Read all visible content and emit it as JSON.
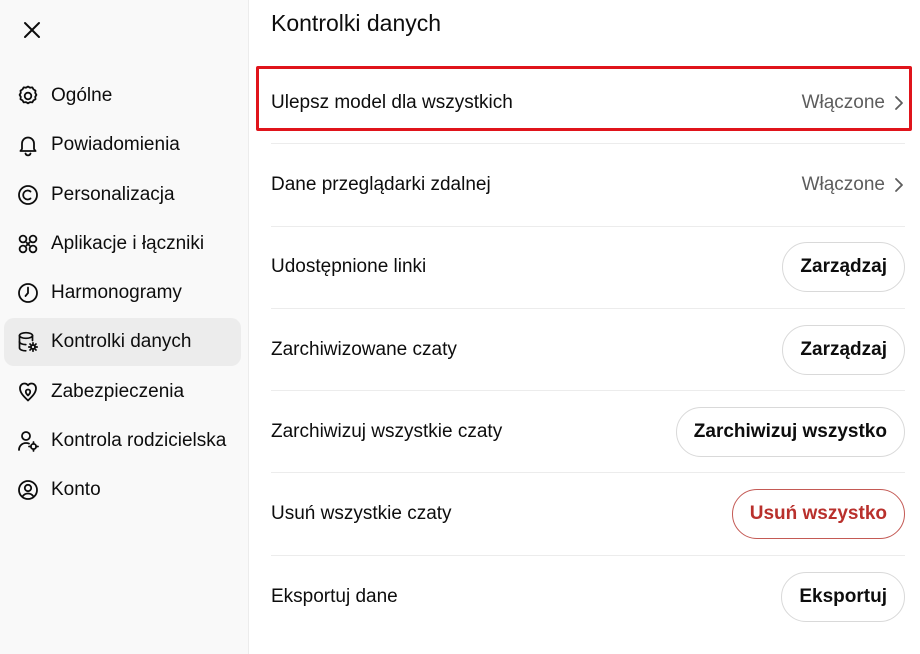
{
  "sidebar": {
    "close_icon": "close-icon",
    "items": [
      {
        "label": "Ogólne",
        "icon": "gear-icon"
      },
      {
        "label": "Powiadomienia",
        "icon": "bell-icon"
      },
      {
        "label": "Personalizacja",
        "icon": "personalization-icon"
      },
      {
        "label": "Aplikacje i łączniki",
        "icon": "apps-icon"
      },
      {
        "label": "Harmonogramy",
        "icon": "clock-icon"
      },
      {
        "label": "Kontrolki danych",
        "icon": "database-icon",
        "active": true
      },
      {
        "label": "Zabezpieczenia",
        "icon": "shield-icon"
      },
      {
        "label": "Kontrola rodzicielska",
        "icon": "parental-icon"
      },
      {
        "label": "Konto",
        "icon": "account-icon"
      }
    ]
  },
  "main": {
    "title": "Kontrolki danych",
    "rows": [
      {
        "label": "Ulepsz model dla wszystkich",
        "value": "Włączone"
      },
      {
        "label": "Dane przeglądarki zdalnej",
        "value": "Włączone"
      },
      {
        "label": "Udostępnione linki",
        "button": "Zarządzaj"
      },
      {
        "label": "Zarchiwizowane czaty",
        "button": "Zarządzaj"
      },
      {
        "label": "Zarchiwizuj wszystkie czaty",
        "button": "Zarchiwizuj wszystko"
      },
      {
        "label": "Usuń wszystkie czaty",
        "button": "Usuń wszystko"
      },
      {
        "label": "Eksportuj dane",
        "button": "Eksportuj"
      }
    ]
  },
  "colors": {
    "highlight": "#e0141b",
    "danger": "#b9302c",
    "sidebar_bg": "#f9f9f9",
    "active_bg": "#ececec"
  }
}
